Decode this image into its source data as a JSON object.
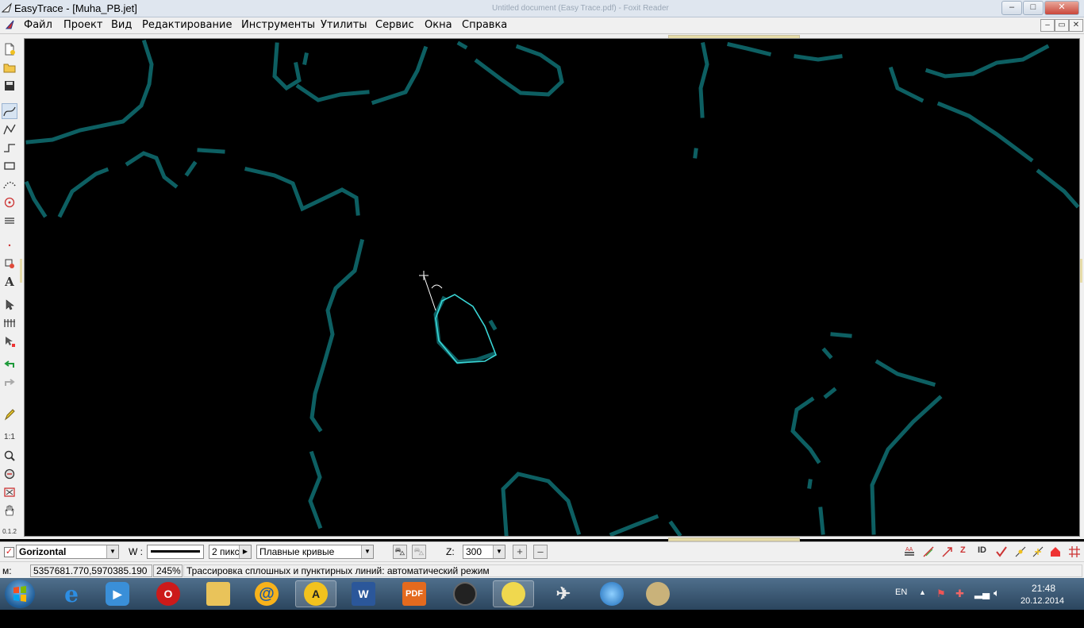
{
  "window": {
    "title": "EasyTrace - [Muha_PB.jet]",
    "faded_title": "Untitled document (Easy Trace.pdf) - Foxit Reader",
    "controls": [
      "–",
      "□",
      "✕"
    ]
  },
  "menu": {
    "items": [
      "Файл",
      "Проект",
      "Вид",
      "Редактирование",
      "Инструменты",
      "Утилиты",
      "Сервис",
      "Окна",
      "Справка"
    ],
    "mdi_controls": [
      "–",
      "▭",
      "✕"
    ]
  },
  "left_toolbar": {
    "tools": [
      {
        "icon": "new-file-icon"
      },
      {
        "icon": "open-folder-icon"
      },
      {
        "icon": "save-disk-icon"
      },
      {
        "icon": "smooth-curve-icon",
        "selected": true
      },
      {
        "icon": "polyline-icon"
      },
      {
        "icon": "step-line-icon"
      },
      {
        "icon": "rectangle-icon"
      },
      {
        "icon": "arc-dotted-icon"
      },
      {
        "icon": "circle-target-icon"
      },
      {
        "icon": "hatch-lines-icon"
      },
      {
        "icon": "point-icon"
      },
      {
        "icon": "symbol-stamp-icon"
      },
      {
        "icon": "text-tool-icon",
        "label": "A"
      },
      {
        "icon": "select-arrow-icon"
      },
      {
        "icon": "vertex-edit-icon"
      },
      {
        "icon": "select-node-icon"
      },
      {
        "icon": "undo-green-icon"
      },
      {
        "icon": "redo-gray-icon"
      },
      {
        "icon": "pencil-icon"
      },
      {
        "icon": "zoom-1to1-icon",
        "label": "1:1"
      },
      {
        "icon": "zoom-magnifier-icon"
      },
      {
        "icon": "zoom-out-icon"
      },
      {
        "icon": "zoom-extent-icon"
      },
      {
        "icon": "pan-hand-icon"
      },
      {
        "icon": "scale-icon",
        "label": "0.1.2"
      }
    ]
  },
  "bottom_toolbar": {
    "layer": {
      "checked": true,
      "value": "Gorizontal"
    },
    "width_label": "W :",
    "width_value": "2 пикс",
    "curve_mode": "Плавные кривые",
    "z_label": "Z:",
    "z_value": "300",
    "plus": "+",
    "minus": "–",
    "right_tools": [
      "layers-icon",
      "trace-line-icon",
      "arrow-tool-icon",
      "z-value-icon",
      "id-icon",
      "check-icon",
      "node-star-icon",
      "snap-icon",
      "house-icon",
      "grid-icon"
    ],
    "right_labels": {
      "z": "Z",
      "id": "ID"
    }
  },
  "status": {
    "mode_label": "м:",
    "coords": "5357681.770,5970385.190",
    "zoom": "245%",
    "message": "Трассировка сплошных и пунктирных линий: автоматический режим"
  },
  "taskbar": {
    "apps": [
      "ie-icon",
      "media-player-icon",
      "opera-icon",
      "file-explorer-icon",
      "mail-agent-icon",
      "easytrace-icon",
      "word-icon",
      "pdf-reader-icon",
      "camera-icon",
      "idea-bulb-icon",
      "paper-plane-icon",
      "globe-icon",
      "paint-palette-icon"
    ],
    "active": [
      "easytrace-icon",
      "idea-bulb-icon"
    ],
    "lang": "EN",
    "time": "21:48",
    "date": "20.12.2014"
  },
  "colors": {
    "canvas": "#000000",
    "contour": "#0d5f62",
    "trace_line": "#3ad6d6",
    "chrome": "#f0f0f0"
  }
}
